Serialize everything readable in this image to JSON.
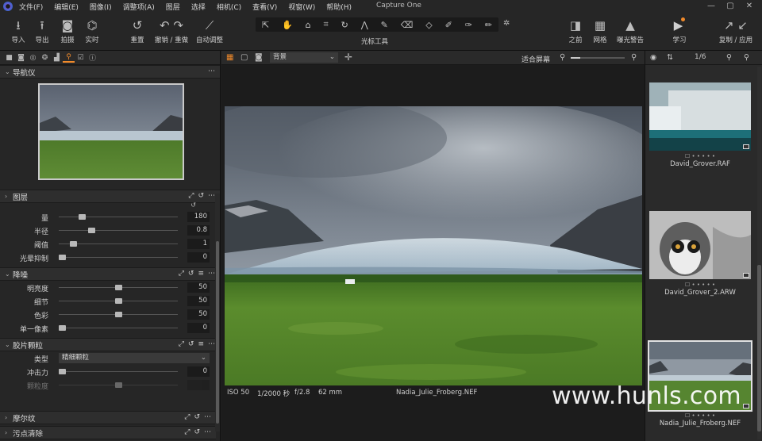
{
  "window": {
    "title": "Capture One",
    "controls": [
      "—",
      "▢",
      "✕"
    ]
  },
  "menu": [
    "文件(F)",
    "编辑(E)",
    "图像(I)",
    "调整项(A)",
    "图层",
    "选择",
    "相机(C)",
    "查看(V)",
    "视窗(W)",
    "帮助(H)"
  ],
  "toolbar": {
    "left": [
      {
        "label": "导入",
        "icon": "import-icon"
      },
      {
        "label": "导出",
        "icon": "export-icon"
      },
      {
        "label": "拍摄",
        "icon": "camera-icon"
      },
      {
        "label": "实时",
        "icon": "live-icon"
      }
    ],
    "middle": [
      {
        "label": "重置",
        "icon": "reset-icon"
      },
      {
        "label": "撤销 / 重做",
        "icon": "undo-redo-icon"
      },
      {
        "label": "自动调整",
        "icon": "auto-adjust-icon"
      }
    ],
    "cursor_tools_label": "光标工具",
    "right": [
      {
        "label": "之前",
        "icon": "before-icon"
      },
      {
        "label": "网格",
        "icon": "grid-icon"
      },
      {
        "label": "曝光警告",
        "icon": "exposure-warning-icon"
      },
      {
        "label": "学习",
        "icon": "learn-icon"
      },
      {
        "label": "复制 / 应用",
        "icon": "copy-apply-icon"
      }
    ]
  },
  "left_panel": {
    "navigator": {
      "title": "导航仪"
    },
    "layers": {
      "title": "图层"
    },
    "clarity_sliders": [
      {
        "label": "量",
        "value": "180",
        "pos": 0.18
      },
      {
        "label": "半径",
        "value": "0.8",
        "pos": 0.26
      },
      {
        "label": "阈值",
        "value": "1",
        "pos": 0.1
      },
      {
        "label": "光晕抑制",
        "value": "0",
        "pos": 0.0
      }
    ],
    "noise_reduction": {
      "title": "降噪",
      "sliders": [
        {
          "label": "明亮度",
          "value": "50",
          "pos": 0.5
        },
        {
          "label": "细节",
          "value": "50",
          "pos": 0.5
        },
        {
          "label": "色彩",
          "value": "50",
          "pos": 0.5
        },
        {
          "label": "单一像素",
          "value": "0",
          "pos": 0.0
        }
      ]
    },
    "film_grain": {
      "title": "胶片颗粒",
      "type_label": "类型",
      "type_value": "精细颗粒",
      "sliders": [
        {
          "label": "冲击力",
          "value": "0",
          "pos": 0.0
        },
        {
          "label": "颗粒度",
          "value": "",
          "pos": 0.5
        }
      ]
    },
    "moire": {
      "title": "摩尔纹"
    },
    "spot_removal": {
      "title": "污点清除"
    }
  },
  "viewer": {
    "variant": "背景",
    "fit_label": "适合屏幕",
    "zoom_fraction": 0.18,
    "info": {
      "iso": "ISO 50",
      "shutter": "1/2000 秒",
      "aperture": "f/2.8",
      "focal": "62 mm",
      "filename": "Nadia_Julie_Froberg.NEF"
    }
  },
  "browser": {
    "counter": "1/6",
    "items": [
      {
        "filename": "David_Grover.RAF",
        "selected": false
      },
      {
        "filename": "David_Grover_2.ARW",
        "selected": false
      },
      {
        "filename": "Nadia_Julie_Froberg.NEF",
        "selected": true
      }
    ],
    "rating_dots": "☐ • • • • •"
  },
  "watermark": "www.hunls.com",
  "colors": {
    "accent": "#f08a2b",
    "panel": "#262626",
    "viewer": "#1c1c1c"
  }
}
